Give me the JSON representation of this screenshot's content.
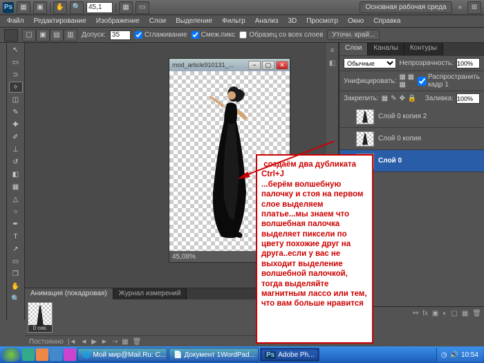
{
  "app": {
    "icon_label": "Ps",
    "zoom_field": "45,1",
    "workspace_label": "Основная рабочая среда"
  },
  "menus": [
    "Файл",
    "Редактирование",
    "Изображение",
    "Слои",
    "Выделение",
    "Фильтр",
    "Анализ",
    "3D",
    "Просмотр",
    "Окно",
    "Справка"
  ],
  "options": {
    "tolerance_label": "Допуск:",
    "tolerance_value": "35",
    "antialias_label": "Сглаживание",
    "contiguous_label": "Смеж.пикс",
    "all_layers_label": "Образец со всех слоев",
    "refine_label": "Уточн. край..."
  },
  "document": {
    "title": "mod_article910131_...",
    "zoom": "45,08%"
  },
  "layers_panel": {
    "tabs": [
      "Слои",
      "Каналы",
      "Контуры"
    ],
    "blend": "Обычные",
    "opacity_label": "Непрозрачность:",
    "opacity_value": "100%",
    "unify_label": "Унифицировать:",
    "propagate_label": "Распространить кадр 1",
    "lock_label": "Закрепить:",
    "fill_label": "Заливка:",
    "fill_value": "100%",
    "layers": [
      {
        "name": "Слой 0 копия 2",
        "selected": false,
        "visible": false
      },
      {
        "name": "Слой 0 копия",
        "selected": false,
        "visible": false
      },
      {
        "name": "Слой 0",
        "selected": true,
        "visible": true
      }
    ]
  },
  "animation": {
    "tabs": [
      "Анимация (покадровая)",
      "Журнал измерений"
    ],
    "frame_label": "0 сек.",
    "loop": "Постоянно"
  },
  "taskbar": {
    "items": [
      {
        "label": "Мой мир@Mail.Ru: С..."
      },
      {
        "label": "Документ 1WordPad..."
      },
      {
        "label": "Adobe Ph..."
      }
    ],
    "clock": "10:54"
  },
  "annotation_text": " создаём два дубликата Ctrl+J\n...берём волшебную палочку и стоя на первом слое выделяем платье...мы знаем что волшебная палочка выделяет пиксели по цвету похожие друг на друга..если у вас не выходит выделение волшебной палочкой, тогда выделяйте магнитным лассо или тем, что вам больше нравится"
}
